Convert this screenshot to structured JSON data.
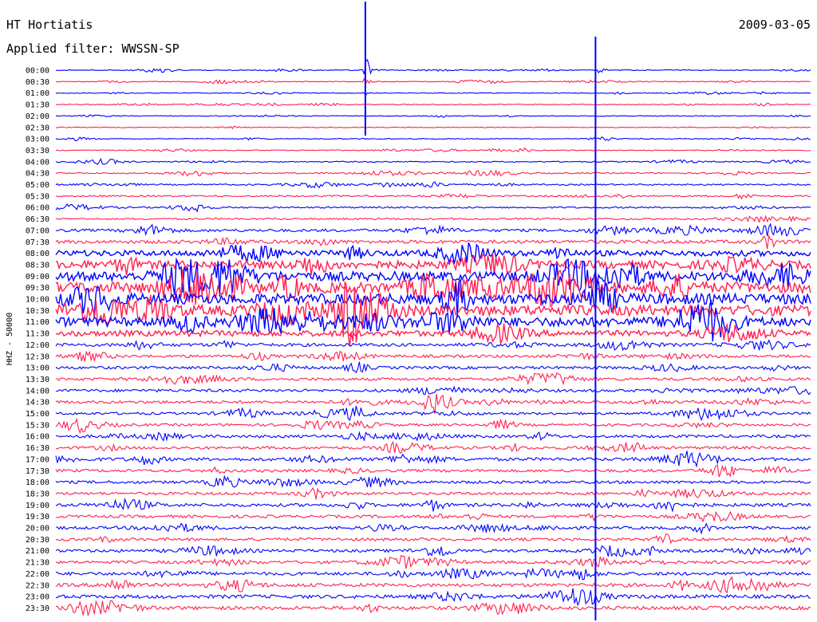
{
  "chart_data": {
    "type": "line",
    "station": "HT Hortiatis",
    "date": "2009-03-05",
    "filter_label": "Applied filter: WWSSN-SP",
    "ylabel": "HHZ - 50000",
    "trace_colors": [
      "#0000ff",
      "#ff2050"
    ],
    "row_labels": [
      "00:00",
      "00:30",
      "01:00",
      "01:30",
      "02:00",
      "02:30",
      "03:00",
      "03:30",
      "04:00",
      "04:30",
      "05:00",
      "05:30",
      "06:00",
      "06:30",
      "07:00",
      "07:30",
      "08:00",
      "08:30",
      "09:00",
      "09:30",
      "10:00",
      "10:30",
      "11:00",
      "11:30",
      "12:00",
      "12:30",
      "13:00",
      "13:30",
      "14:00",
      "14:30",
      "15:00",
      "15:30",
      "16:00",
      "16:30",
      "17:00",
      "17:30",
      "18:00",
      "18:30",
      "19:00",
      "19:30",
      "20:00",
      "20:30",
      "21:00",
      "21:30",
      "22:00",
      "22:30",
      "23:00",
      "23:30"
    ],
    "noise_level": [
      0.22,
      0.22,
      0.2,
      0.22,
      0.2,
      0.22,
      0.22,
      0.25,
      0.3,
      0.35,
      0.4,
      0.45,
      0.45,
      0.5,
      0.8,
      1.0,
      1.6,
      2.2,
      2.6,
      3.0,
      3.0,
      3.0,
      2.6,
      1.6,
      0.9,
      0.8,
      0.8,
      0.8,
      0.8,
      0.8,
      0.7,
      0.7,
      0.8,
      0.8,
      0.9,
      0.8,
      0.8,
      0.8,
      0.9,
      0.8,
      0.8,
      0.8,
      0.8,
      0.8,
      0.9,
      1.0,
      1.0,
      1.0
    ],
    "events": [
      {
        "row": 0,
        "position": 0.41,
        "amplitude": 9.0,
        "label": ""
      },
      {
        "row": 1,
        "position": 0.41,
        "amplitude": 2.0,
        "label": ""
      },
      {
        "row": 2,
        "position": 0.41,
        "amplitude": 1.5,
        "label": ""
      },
      {
        "row": 0,
        "position": 0.715,
        "amplitude": 4.0,
        "label": ""
      }
    ]
  }
}
